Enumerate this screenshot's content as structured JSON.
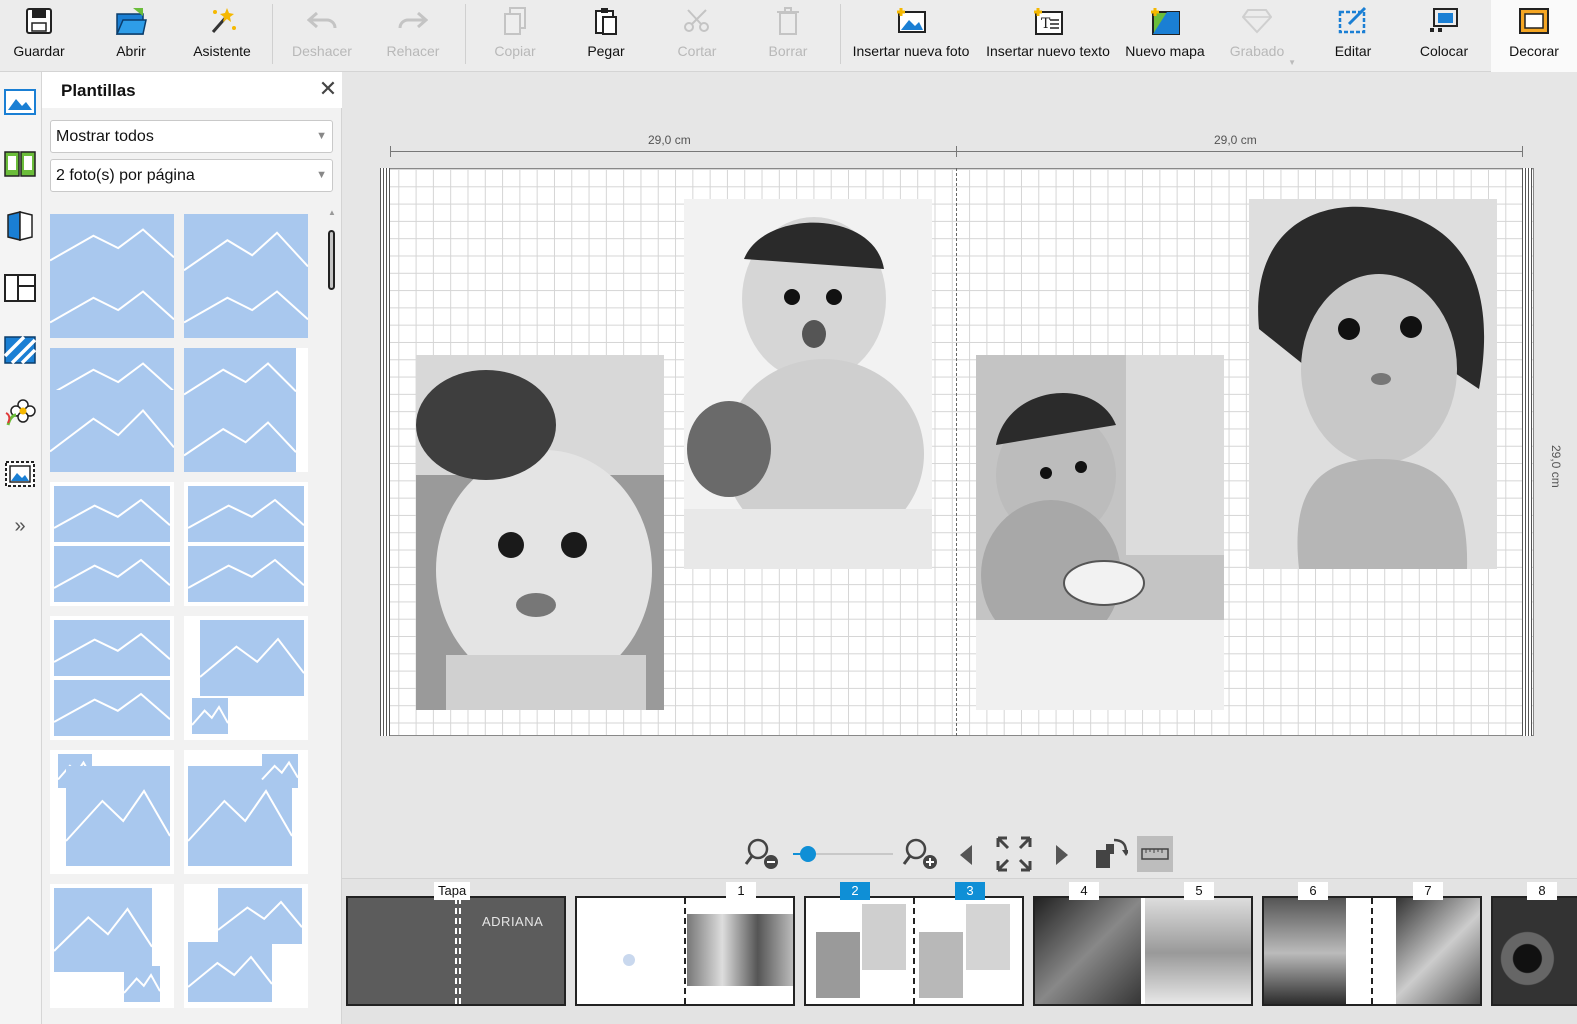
{
  "toolbar": {
    "buttons": [
      {
        "label": "Guardar"
      },
      {
        "label": "Abrir"
      },
      {
        "label": "Asistente"
      },
      {
        "label": "Deshacer"
      },
      {
        "label": "Rehacer"
      },
      {
        "label": "Copiar"
      },
      {
        "label": "Pegar"
      },
      {
        "label": "Cortar"
      },
      {
        "label": "Borrar"
      },
      {
        "label": "Insertar nueva foto"
      },
      {
        "label": "Insertar nuevo texto"
      },
      {
        "label": "Nuevo mapa"
      },
      {
        "label": "Grabado"
      },
      {
        "label": "Editar"
      },
      {
        "label": "Colocar"
      },
      {
        "label": "Decorar"
      }
    ]
  },
  "panel": {
    "title": "Plantillas",
    "close_glyph": "✕",
    "filter_select": "Mostrar todos",
    "layout_select": "2 foto(s) por página"
  },
  "ruler": {
    "left_width": "29,0 cm",
    "right_width": "29,0 cm",
    "height": "29,0 cm"
  },
  "pages": [
    {
      "label": "Tapa",
      "selected": false,
      "cover_text": "ADRIANA"
    },
    {
      "label": "1",
      "selected": false
    },
    {
      "label": "2",
      "selected": true
    },
    {
      "label": "3",
      "selected": true
    },
    {
      "label": "4",
      "selected": false
    },
    {
      "label": "5",
      "selected": false
    },
    {
      "label": "6",
      "selected": false
    },
    {
      "label": "7",
      "selected": false
    },
    {
      "label": "8",
      "selected": false
    }
  ],
  "colors": {
    "accent": "#0f8fd6",
    "template_sky": "#a9c8ee",
    "icon_blue": "#1a7fd4"
  },
  "zoom": {
    "level": 0.15
  }
}
